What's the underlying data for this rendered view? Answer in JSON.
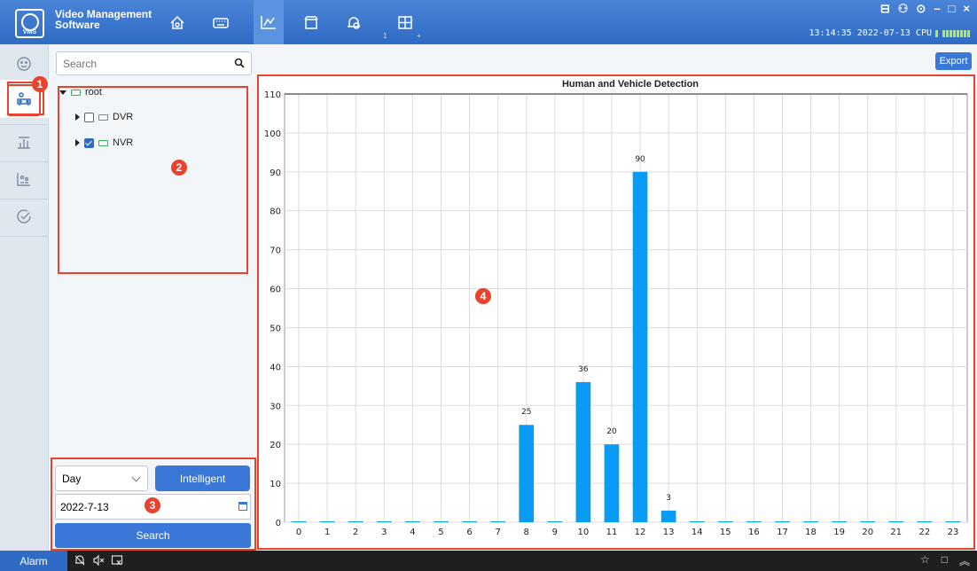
{
  "app": {
    "name_line1": "Video Management",
    "name_line2": "Software",
    "logo_text": "VMS"
  },
  "topnav": {
    "icons": [
      "home-icon",
      "keyboard-icon",
      "chart-icon",
      "storage-icon",
      "alarm-settings-icon",
      "layout-icon"
    ],
    "active_index": 2,
    "sub_label": "1"
  },
  "window": {
    "controls": [
      "□",
      "⚇",
      "⊙",
      "–",
      "□",
      "×"
    ]
  },
  "status": {
    "time": "13:14:35 2022-07-13 CPU"
  },
  "rail": {
    "items": [
      "face-icon",
      "human-vehicle-icon",
      "statistics-icon",
      "people-count-icon",
      "check-icon"
    ],
    "active_index": 1
  },
  "left_panel": {
    "search_placeholder": "Search",
    "tree": [
      {
        "label": "root",
        "expanded": true,
        "level": 0
      },
      {
        "label": "DVR",
        "checked": false,
        "level": 1
      },
      {
        "label": "NVR",
        "checked": true,
        "level": 1
      }
    ],
    "period_select": "Day",
    "intelligent_button": "Intelligent",
    "date_value": "2022-7-13",
    "search_button": "Search"
  },
  "markers": [
    "1",
    "2",
    "3",
    "4"
  ],
  "main": {
    "export_button": "Export"
  },
  "chart_data": {
    "type": "bar",
    "title": "Human and Vehicle Detection",
    "xlabel": "",
    "ylabel": "",
    "categories": [
      "0",
      "1",
      "2",
      "3",
      "4",
      "5",
      "6",
      "7",
      "8",
      "9",
      "10",
      "11",
      "12",
      "13",
      "14",
      "15",
      "16",
      "17",
      "18",
      "19",
      "20",
      "21",
      "22",
      "23"
    ],
    "values": [
      0,
      0,
      0,
      0,
      0,
      0,
      0,
      0,
      25,
      0,
      36,
      20,
      90,
      3,
      0,
      0,
      0,
      0,
      0,
      0,
      0,
      0,
      0,
      0
    ],
    "ylim": [
      0,
      110
    ],
    "yticks": [
      0,
      10,
      20,
      30,
      40,
      50,
      60,
      70,
      80,
      90,
      100,
      110
    ],
    "grid": true,
    "bar_color": "#0a9bf5",
    "show_value_labels_nonzero": true
  },
  "taskbar": {
    "alarm_label": "Alarm"
  }
}
